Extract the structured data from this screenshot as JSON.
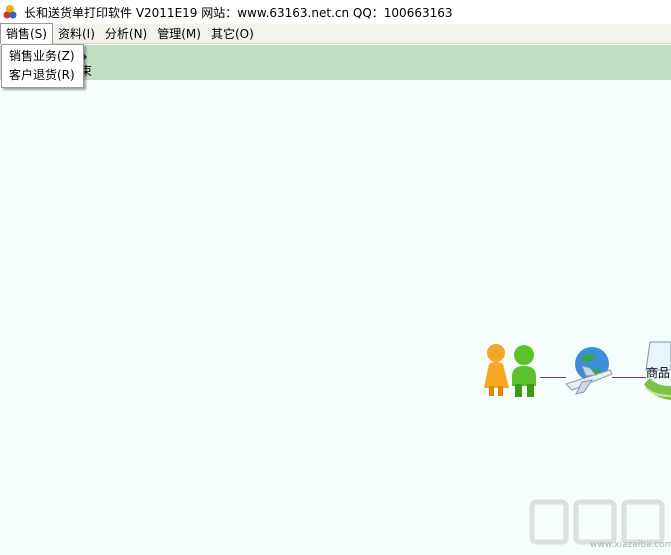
{
  "window": {
    "title": "长和送货单打印软件 V2011E19  网站：www.63163.net.cn  QQ：100663163",
    "icon": "app-icon"
  },
  "menubar": {
    "items": [
      {
        "label": "销售(S)"
      },
      {
        "label": "资料(I)"
      },
      {
        "label": "分析(N)"
      },
      {
        "label": "管理(M)"
      },
      {
        "label": "其它(O)"
      }
    ]
  },
  "sales_menu": {
    "items": [
      {
        "label": "销售业务(Z)"
      },
      {
        "label": "客户退货(R)"
      }
    ]
  },
  "partially_hidden_label": "束",
  "flowchart": {
    "icons": [
      "customer-icon",
      "airplane-globe-icon",
      "goods-icon"
    ],
    "goods_label": "商品"
  },
  "watermark": {
    "text": "下载吧",
    "url": "www.xiazaiba.com"
  },
  "colors": {
    "background": "#f5fdfd",
    "green_band": "#c2dfc2",
    "flow_line": "#7a3a6a"
  }
}
